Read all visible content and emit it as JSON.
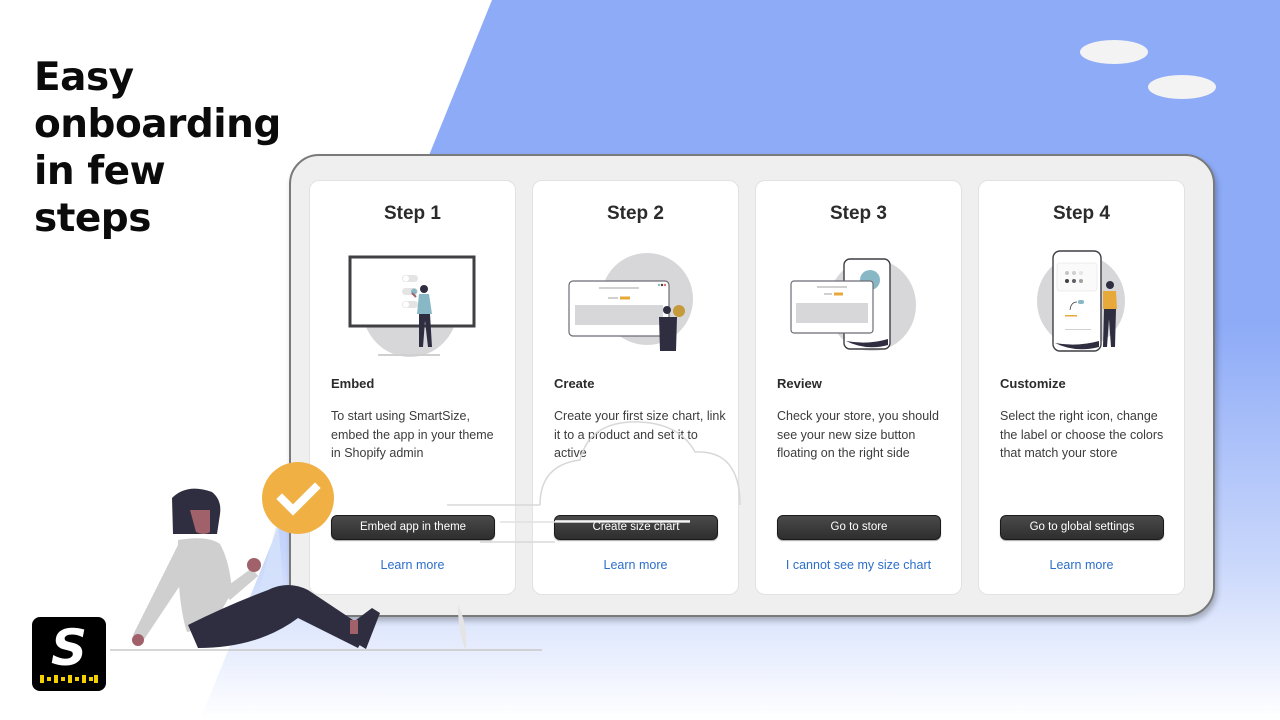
{
  "headline": {
    "lines": [
      "Easy",
      "onboarding",
      "in few",
      "steps"
    ]
  },
  "colors": {
    "background_blue": "#8eabf7",
    "button_dark": "#2e2e2e",
    "link_blue": "#2c6ecb",
    "check_badge": "#f0b044",
    "logo_ruler": "#f5d000"
  },
  "steps": [
    {
      "title": "Step 1",
      "illustration": "monitor-toggles-illustration",
      "heading": "Embed",
      "description": "To start using SmartSize, embed the app in your theme in Shopify admin",
      "button_label": "Embed app in theme",
      "link_label": "Learn more"
    },
    {
      "title": "Step 2",
      "illustration": "browser-size-chart-illustration",
      "heading": "Create",
      "description": "Create your first size chart, link it to a product and set it to active",
      "button_label": "Create size chart",
      "link_label": "Learn more"
    },
    {
      "title": "Step 3",
      "illustration": "phone-browser-review-illustration",
      "heading": "Review",
      "description": "Check your store, you should see your new size button floating on the right side",
      "button_label": "Go to store",
      "link_label": "I cannot see my size chart"
    },
    {
      "title": "Step 4",
      "illustration": "phone-customize-illustration",
      "heading": "Customize",
      "description": "Select the right icon, change the label or choose the colors that match your store",
      "button_label": "Go to global settings",
      "link_label": "Learn more"
    }
  ],
  "logo": {
    "letter": "S",
    "icon": "smartsize-logo"
  },
  "decor": {
    "check_icon": "check-badge-icon",
    "character": "sitting-woman-illustration"
  }
}
